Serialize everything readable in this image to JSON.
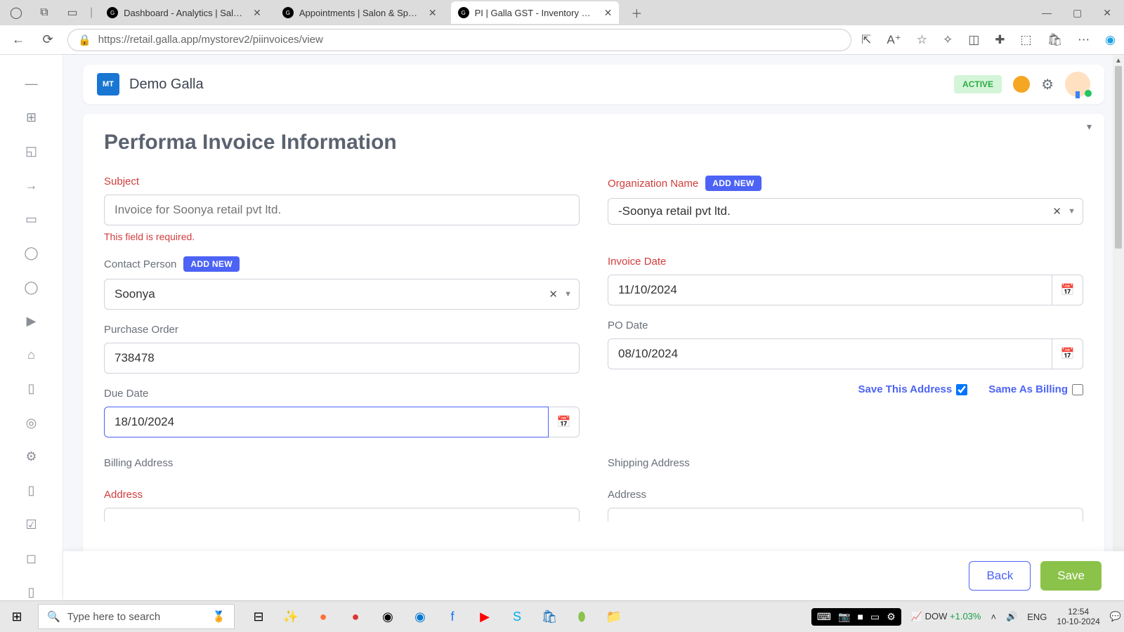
{
  "browser": {
    "tabs": [
      {
        "label": "Dashboard - Analytics | Salon & S"
      },
      {
        "label": "Appointments | Salon & Spa Man"
      },
      {
        "label": "PI | Galla GST - Inventory Software"
      }
    ],
    "url": "https://retail.galla.app/mystorev2/piinvoices/view"
  },
  "header": {
    "brand": "Demo Galla",
    "logo_text": "MT",
    "status": "ACTIVE"
  },
  "page_title": "Performa Invoice Information",
  "fields": {
    "subject": {
      "label": "Subject",
      "placeholder": "Invoice for Soonya retail pvt ltd.",
      "error": "This field is required."
    },
    "org": {
      "label": "Organization Name",
      "btn": "ADD NEW",
      "value": "-Soonya retail pvt ltd."
    },
    "contact": {
      "label": "Contact Person",
      "btn": "ADD NEW",
      "value": "Soonya"
    },
    "invdate": {
      "label": "Invoice Date",
      "value": "11/10/2024"
    },
    "po": {
      "label": "Purchase Order",
      "value": "738478"
    },
    "podate": {
      "label": "PO Date",
      "value": "08/10/2024"
    },
    "due": {
      "label": "Due Date",
      "value": "18/10/2024"
    },
    "save_addr": "Save This Address",
    "same_bill": "Same As Billing",
    "billing": "Billing Address",
    "shipping": "Shipping Address",
    "addr_label": "Address"
  },
  "buttons": {
    "back": "Back",
    "save": "Save"
  },
  "taskbar": {
    "search": "Type here to search",
    "stock_sym": "DOW",
    "stock_pct": "+1.03%",
    "lang": "ENG",
    "time": "12:54",
    "date": "10-10-2024"
  }
}
